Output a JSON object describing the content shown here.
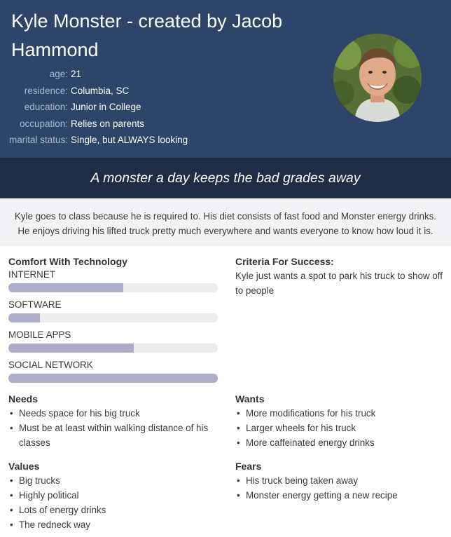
{
  "header": {
    "title": "Kyle Monster - created by Jacob Hammond",
    "facts": [
      {
        "label": "age:",
        "value": "21"
      },
      {
        "label": "residence:",
        "value": "Columbia, SC"
      },
      {
        "label": "education:",
        "value": "Junior in College"
      },
      {
        "label": "occupation:",
        "value": "Relies on parents"
      },
      {
        "label": "marital status:",
        "value": "Single, but ALWAYS looking"
      }
    ]
  },
  "quote": "A monster a day keeps the bad grades away",
  "bio": "Kyle goes to class because he is required to. His diet consists of fast food and Monster energy drinks. He enjoys driving his lifted truck pretty much everywhere and wants everyone to know how loud it is.",
  "technology": {
    "title": "Comfort With Technology",
    "items": [
      {
        "label": "INTERNET",
        "level": 0.55
      },
      {
        "label": "SOFTWARE",
        "level": 0.15
      },
      {
        "label": "MOBILE APPS",
        "level": 0.6
      },
      {
        "label": "SOCIAL NETWORK",
        "level": 1.0
      }
    ]
  },
  "success": {
    "title": "Criteria For Success:",
    "text": "Kyle just wants a spot to park his truck to show off to people"
  },
  "needs": {
    "title": "Needs",
    "items": [
      "Needs space for his big truck",
      "Must be at least within walking distance of his classes"
    ]
  },
  "wants": {
    "title": "Wants",
    "items": [
      "More modifications for his truck",
      "Larger wheels for his truck",
      "More caffeinated energy drinks"
    ]
  },
  "values": {
    "title": "Values",
    "items": [
      "Big trucks",
      "Highly political",
      "Lots of energy drinks",
      "The redneck way"
    ]
  },
  "fears": {
    "title": "Fears",
    "items": [
      "His truck being taken away",
      "Monster energy getting a new recipe"
    ]
  },
  "colors": {
    "header_bg": "#2e4468",
    "quote_bg": "#1e2c44",
    "bar_fill": "#aeaccb",
    "bar_track": "#ececef"
  }
}
